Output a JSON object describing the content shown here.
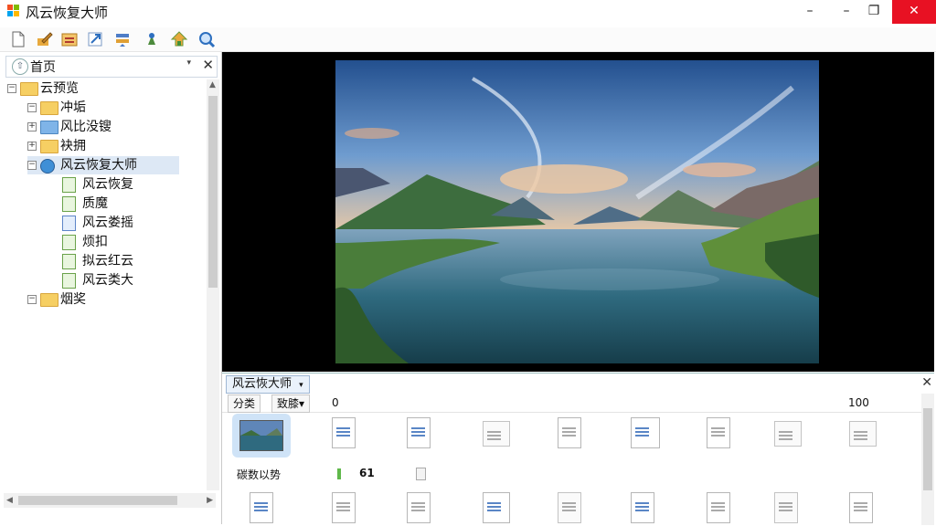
{
  "window": {
    "title": "风云恢复大师",
    "minimize_glyph": "–",
    "restore_glyph": "❐",
    "close_glyph": "✕"
  },
  "toolbar": {
    "buttons": [
      {
        "icon": "new-file-icon"
      },
      {
        "icon": "edit-icon"
      },
      {
        "icon": "archive-icon"
      },
      {
        "icon": "export-icon"
      },
      {
        "icon": "transfer-icon"
      },
      {
        "icon": "pin-icon"
      },
      {
        "icon": "tree-icon"
      },
      {
        "icon": "search-icon"
      }
    ]
  },
  "nav": {
    "label": "首页",
    "dropdown_glyph": "▾",
    "close_glyph": "✕"
  },
  "tree": {
    "nodes": [
      {
        "label": "云预览",
        "icon": "folder-icon",
        "depth": 0,
        "expander": "−"
      },
      {
        "label": "冲垢",
        "icon": "folder-icon",
        "depth": 1,
        "expander": "−"
      },
      {
        "label": "风比没锼",
        "icon": "folder-icon-blue",
        "depth": 1,
        "expander": "+"
      },
      {
        "label": "袂拥",
        "icon": "folder-icon",
        "depth": 1,
        "expander": "+"
      },
      {
        "label": "风云恢复大师",
        "icon": "app-icon",
        "depth": 1,
        "expander": "−",
        "selected": true
      },
      {
        "label": "风云恢复",
        "icon": "doc-icon-green",
        "depth": 2
      },
      {
        "label": "质魔",
        "icon": "doc-icon-green",
        "depth": 2
      },
      {
        "label": "风云娄摇",
        "icon": "doc-icon-blue",
        "depth": 2
      },
      {
        "label": "烦扣",
        "icon": "doc-icon-green",
        "depth": 2
      },
      {
        "label": "拟云红云",
        "icon": "doc-icon-green",
        "depth": 2
      },
      {
        "label": "风云类大",
        "icon": "doc-icon-green",
        "depth": 2
      },
      {
        "label": "烟奖",
        "icon": "folder-icon",
        "depth": 1,
        "expander": "−"
      }
    ]
  },
  "bottom": {
    "tab_label": "风云恢大师",
    "tab_chevron": "▾",
    "columns": {
      "sort": "分类",
      "filter": "致膝▾",
      "v0": "0",
      "v100": "100"
    },
    "meta": {
      "label": "碳数以势",
      "value": "61"
    }
  }
}
